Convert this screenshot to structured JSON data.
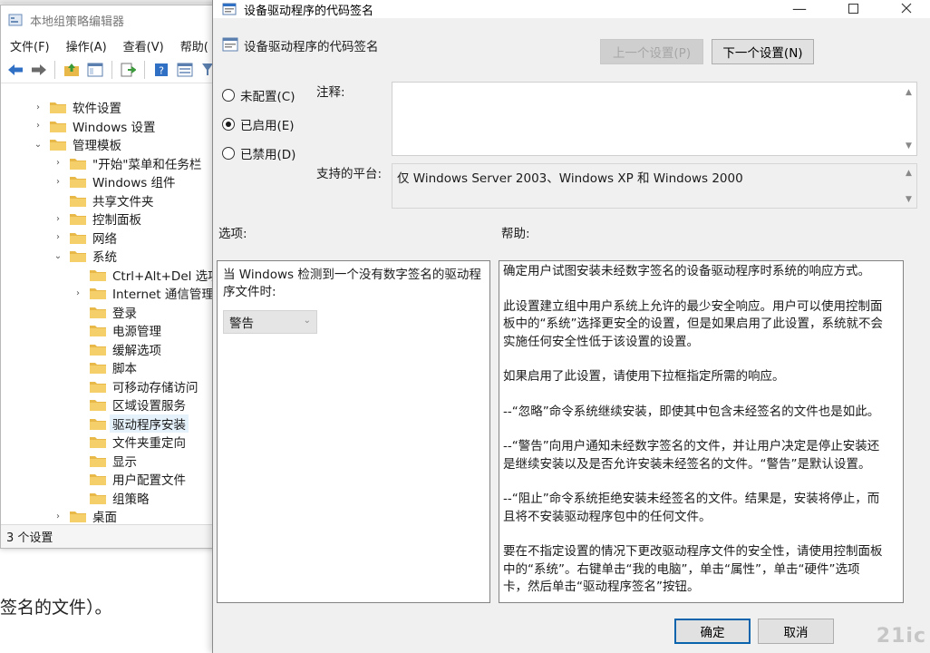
{
  "background": {
    "doc_text": "签名的文件）。"
  },
  "gpedit": {
    "title": "本地组策略编辑器",
    "menu": [
      "文件(F)",
      "操作(A)",
      "查看(V)",
      "帮助("
    ],
    "tree": [
      {
        "label": "软件设置",
        "indent": 0,
        "arrow": "›"
      },
      {
        "label": "Windows 设置",
        "indent": 0,
        "arrow": "›"
      },
      {
        "label": "管理模板",
        "indent": 0,
        "arrow": "⌄"
      },
      {
        "label": "\"开始\"菜单和任务栏",
        "indent": 1,
        "arrow": "›"
      },
      {
        "label": "Windows 组件",
        "indent": 1,
        "arrow": "›"
      },
      {
        "label": "共享文件夹",
        "indent": 1,
        "arrow": ""
      },
      {
        "label": "控制面板",
        "indent": 1,
        "arrow": "›"
      },
      {
        "label": "网络",
        "indent": 1,
        "arrow": "›"
      },
      {
        "label": "系统",
        "indent": 1,
        "arrow": "⌄"
      },
      {
        "label": "Ctrl+Alt+Del 选项",
        "indent": 2,
        "arrow": ""
      },
      {
        "label": "Internet 通信管理",
        "indent": 2,
        "arrow": "›"
      },
      {
        "label": "登录",
        "indent": 2,
        "arrow": ""
      },
      {
        "label": "电源管理",
        "indent": 2,
        "arrow": ""
      },
      {
        "label": "缓解选项",
        "indent": 2,
        "arrow": ""
      },
      {
        "label": "脚本",
        "indent": 2,
        "arrow": ""
      },
      {
        "label": "可移动存储访问",
        "indent": 2,
        "arrow": ""
      },
      {
        "label": "区域设置服务",
        "indent": 2,
        "arrow": ""
      },
      {
        "label": "驱动程序安装",
        "indent": 2,
        "arrow": "",
        "selected": true
      },
      {
        "label": "文件夹重定向",
        "indent": 2,
        "arrow": ""
      },
      {
        "label": "显示",
        "indent": 2,
        "arrow": ""
      },
      {
        "label": "用户配置文件",
        "indent": 2,
        "arrow": ""
      },
      {
        "label": "组策略",
        "indent": 2,
        "arrow": ""
      },
      {
        "label": "桌面",
        "indent": 1,
        "arrow": "›"
      }
    ],
    "status": "3 个设置"
  },
  "dialog": {
    "title": "设备驱动程序的代码签名",
    "policy_name": "设备驱动程序的代码签名",
    "prev_button": "上一个设置(P)",
    "next_button": "下一个设置(N)",
    "radio_not_configured": "未配置(C)",
    "radio_enabled": "已启用(E)",
    "radio_disabled": "已禁用(D)",
    "selected_state": "enabled",
    "comment_label": "注释:",
    "comment_value": "",
    "platform_label": "支持的平台:",
    "platform_value": "仅 Windows Server 2003、Windows XP 和 Windows 2000",
    "options_label": "选项:",
    "help_label": "帮助:",
    "option_prompt": "当 Windows 检测到一个没有数字签名的驱动程序文件时:",
    "option_value": "警告",
    "help_paragraphs": [
      "确定用户试图安装未经数字签名的设备驱动程序时系统的响应方式。",
      "此设置建立组中用户系统上允许的最少安全响应。用户可以使用控制面板中的“系统”选择更安全的设置，但是如果启用了此设置，系统就不会实施任何安全性低于该设置的设置。",
      "如果启用了此设置，请使用下拉框指定所需的响应。",
      "--“忽略”命令系统继续安装，即使其中包含未经签名的文件也是如此。",
      "--“警告”向用户通知未经数字签名的文件，并让用户决定是停止安装还是继续安装以及是否允许安装未经签名的文件。“警告”是默认设置。",
      "--“阻止”命令系统拒绝安装未经签名的文件。结果是，安装将停止，而且将不安装驱动程序包中的任何文件。",
      "要在不指定设置的情况下更改驱动程序文件的安全性，请使用控制面板中的“系统”。右键单击“我的电脑”，单击“属性”，单击“硬件”选项卡，然后单击“驱动程序签名”按钮。"
    ],
    "ok_button": "确定",
    "cancel_button": "取消",
    "watermark": "21ic"
  },
  "colors": {
    "accent": "#0a64ad",
    "folder": "#e8b949",
    "selection": "#e5f1fb"
  }
}
